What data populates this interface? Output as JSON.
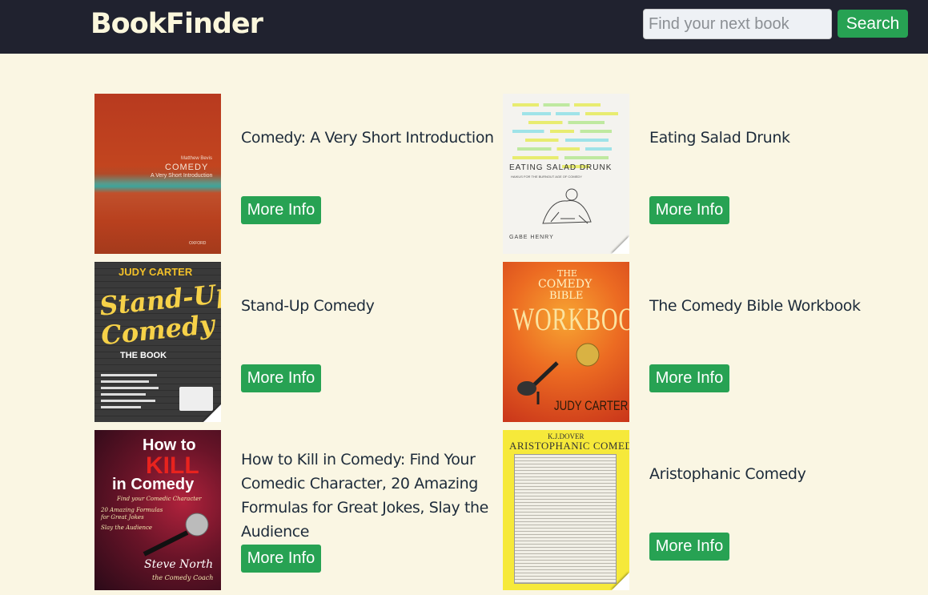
{
  "header": {
    "brand": "BookFinder",
    "search_placeholder": "Find your next book",
    "search_button": "Search"
  },
  "books": [
    {
      "title": "Comedy: A Very Short Introduction",
      "button": "More Info",
      "cover": {
        "author": "Matthew Bevis",
        "main": "COMEDY",
        "sub": "A Very Short Introduction",
        "publisher": "OXFORD"
      }
    },
    {
      "title": "Eating Salad Drunk",
      "button": "More Info",
      "cover": {
        "main": "EATING SALAD DRUNK",
        "sub": "HAIKUS FOR THE BURNOUT AGE OF COMEDY",
        "author": "GABE HENRY"
      }
    },
    {
      "title": "Stand-Up Comedy",
      "button": "More Info",
      "cover": {
        "author": "JUDY CARTER",
        "line1": "Stand-Up",
        "line2": "Comedy",
        "sub": "THE BOOK"
      }
    },
    {
      "title": "The Comedy Bible Workbook",
      "button": "More Info",
      "cover": {
        "line1": "THE",
        "line2": "COMEDY",
        "line3": "BIBLE",
        "main": "WORKBOOK",
        "author": "JUDY CARTER"
      }
    },
    {
      "title": "How to Kill in Comedy: Find Your Comedic Character, 20 Amazing Formulas for Great Jokes, Slay the Audience",
      "button": "More Info",
      "cover": {
        "line1": "How to",
        "line2": "KILL",
        "line3": "in Comedy",
        "sub1": "Find your Comedic Character",
        "sub2": "20 Amazing Formulas",
        "sub3": "for Great Jokes",
        "sub4": "Slay the Audience",
        "author": "Steve North",
        "tag": "the Comedy Coach"
      }
    },
    {
      "title": "Aristophanic Comedy",
      "button": "More Info",
      "cover": {
        "author": "K.J.DOVER",
        "main": "ARISTOPHANIC COMEDY"
      }
    }
  ]
}
